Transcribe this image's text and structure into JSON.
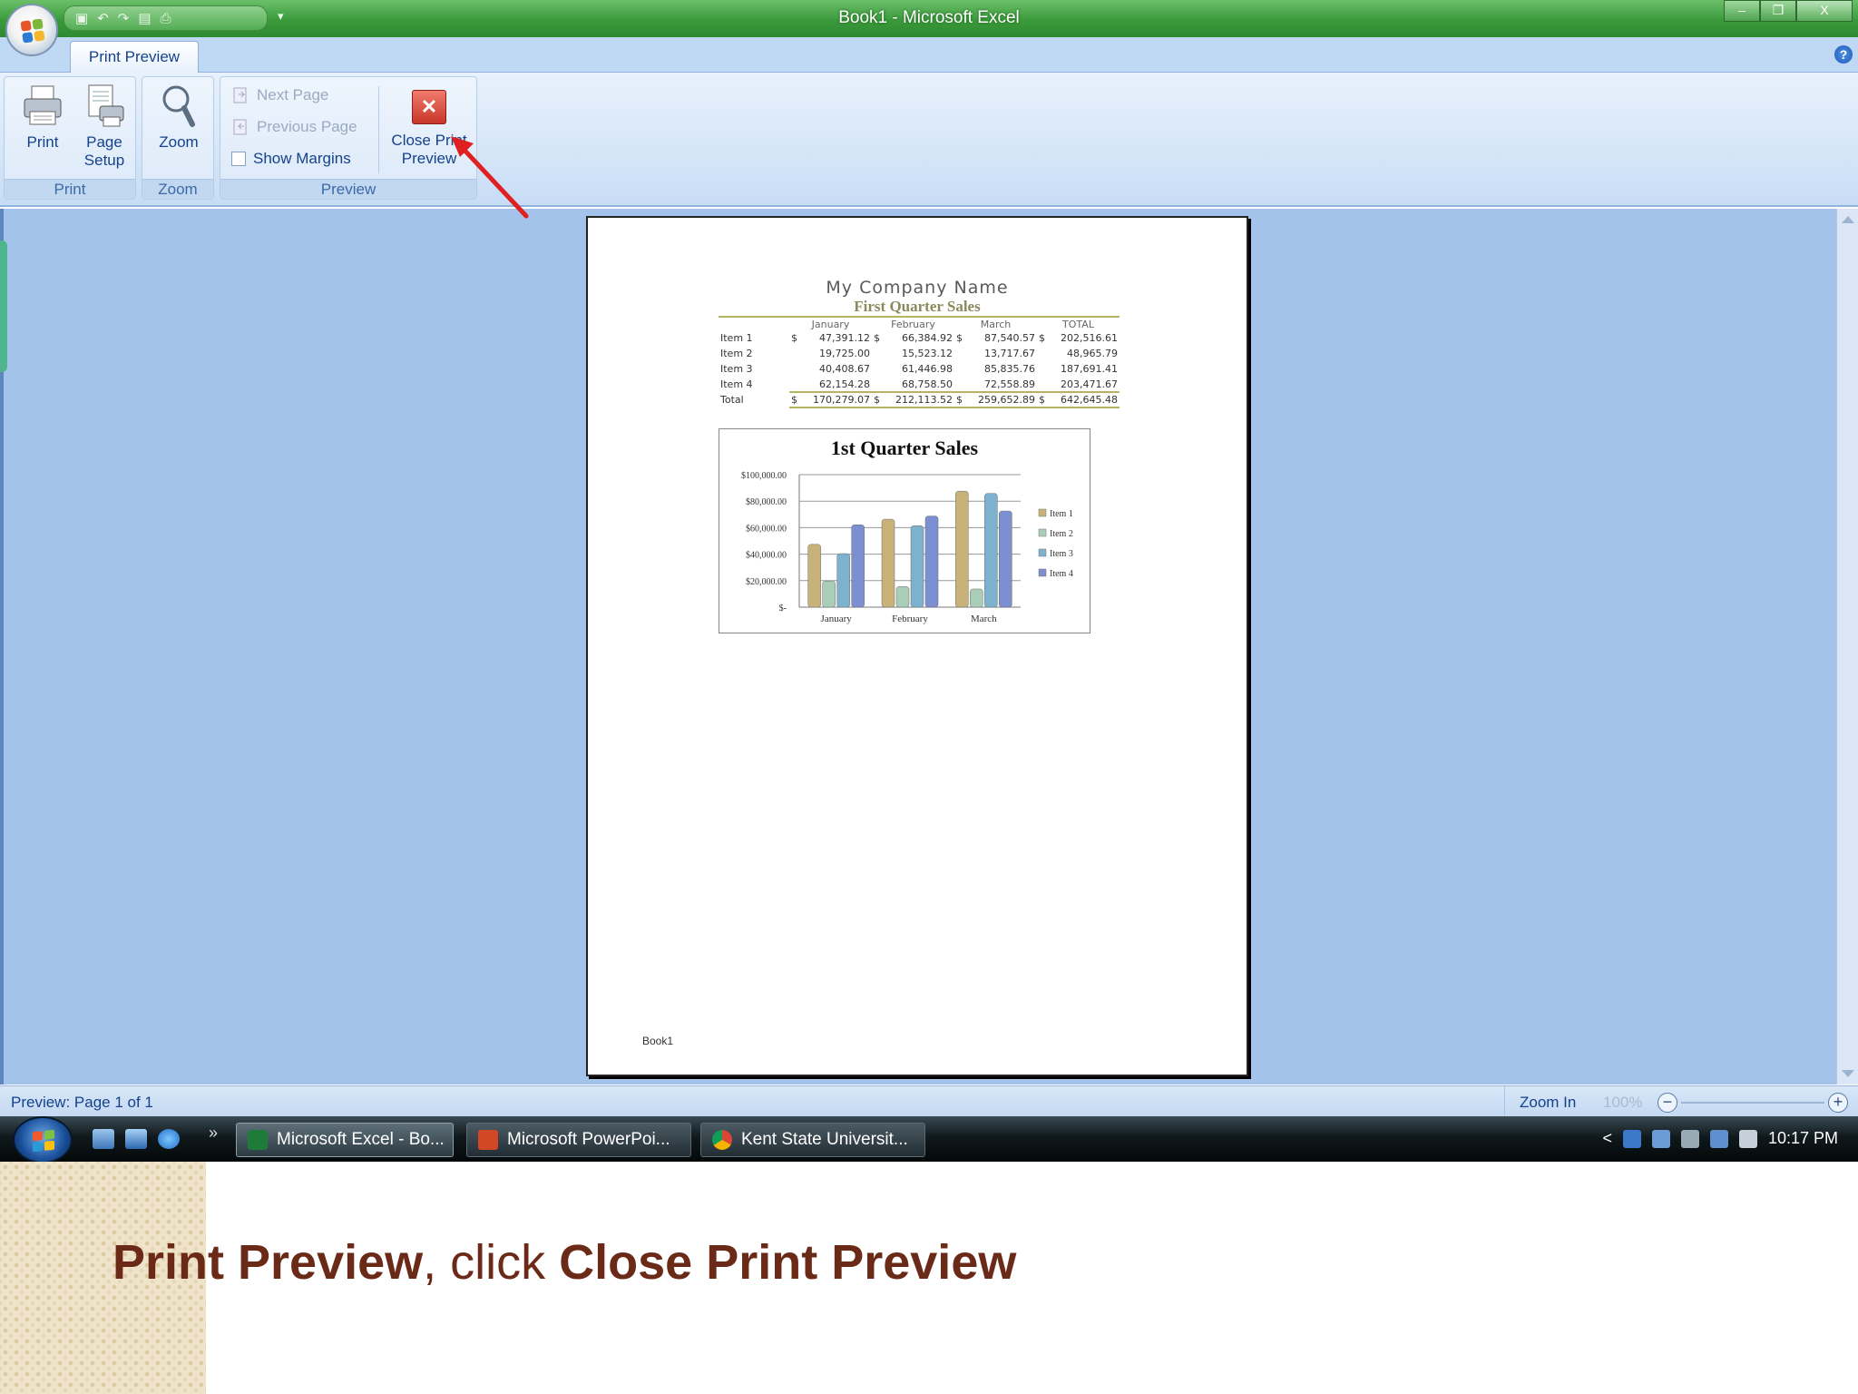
{
  "window": {
    "title": "Book1 - Microsoft Excel"
  },
  "ribbon": {
    "tab_label": "Print Preview",
    "groups": {
      "print": {
        "label": "Print",
        "print_label": "Print",
        "page_setup_label": "Page\nSetup"
      },
      "zoom": {
        "label": "Zoom",
        "zoom_label": "Zoom"
      },
      "preview": {
        "label": "Preview",
        "next_page": "Next Page",
        "previous_page": "Previous Page",
        "show_margins": "Show Margins",
        "close_label": "Close Print\nPreview"
      }
    }
  },
  "page": {
    "company": "My Company Name",
    "subtitle": "First Quarter Sales",
    "columns": [
      "",
      "January",
      "February",
      "March",
      "TOTAL"
    ],
    "rows": [
      {
        "label": "Item 1",
        "values": [
          "47,391.12",
          "66,384.92",
          "87,540.57",
          "202,516.61"
        ],
        "dollar": true
      },
      {
        "label": "Item 2",
        "values": [
          "19,725.00",
          "15,523.12",
          "13,717.67",
          "48,965.79"
        ],
        "dollar": false
      },
      {
        "label": "Item 3",
        "values": [
          "40,408.67",
          "61,446.98",
          "85,835.76",
          "187,691.41"
        ],
        "dollar": false
      },
      {
        "label": "Item 4",
        "values": [
          "62,154.28",
          "68,758.50",
          "72,558.89",
          "203,471.67"
        ],
        "dollar": false
      }
    ],
    "total": {
      "label": "Total",
      "values": [
        "170,279.07",
        "212,113.52",
        "259,652.89",
        "642,645.48"
      ]
    },
    "dollar_sign": "$",
    "footer": "Book1"
  },
  "chart_data": {
    "type": "bar",
    "title": "1st Quarter Sales",
    "categories": [
      "January",
      "February",
      "March"
    ],
    "series": [
      {
        "name": "Item 1",
        "values": [
          47391.12,
          66384.92,
          87540.57
        ]
      },
      {
        "name": "Item 2",
        "values": [
          19725.0,
          15523.12,
          13717.67
        ]
      },
      {
        "name": "Item 3",
        "values": [
          40408.67,
          61446.98,
          85835.76
        ]
      },
      {
        "name": "Item 4",
        "values": [
          62154.28,
          68758.5,
          72558.89
        ]
      }
    ],
    "y_ticks": [
      "$100,000.00",
      "$80,000.00",
      "$60,000.00",
      "$40,000.00",
      "$20,000.00",
      "$-"
    ],
    "ylim": [
      0,
      100000
    ],
    "grid": true,
    "legend": "right",
    "colors": [
      "#c8b27a",
      "#a9cdb7",
      "#7db2cf",
      "#7b8fd1"
    ]
  },
  "status": {
    "text": "Preview: Page 1 of 1",
    "zoom_in": "Zoom In",
    "zoom_pct": "100%",
    "minus": "−",
    "plus": "+"
  },
  "taskbar": {
    "tasks": [
      "Microsoft Excel - Bo...",
      "Microsoft PowerPoi...",
      "Kent State Universit..."
    ],
    "time": "10:17 PM",
    "more": "»",
    "tray_arrow": "<"
  },
  "caption": {
    "part1": "Print Preview",
    "part2": ", click ",
    "part3": "Close Print Preview"
  },
  "window_controls": {
    "min": "–",
    "max": "❐",
    "close": "X"
  },
  "help_glyph": "?"
}
